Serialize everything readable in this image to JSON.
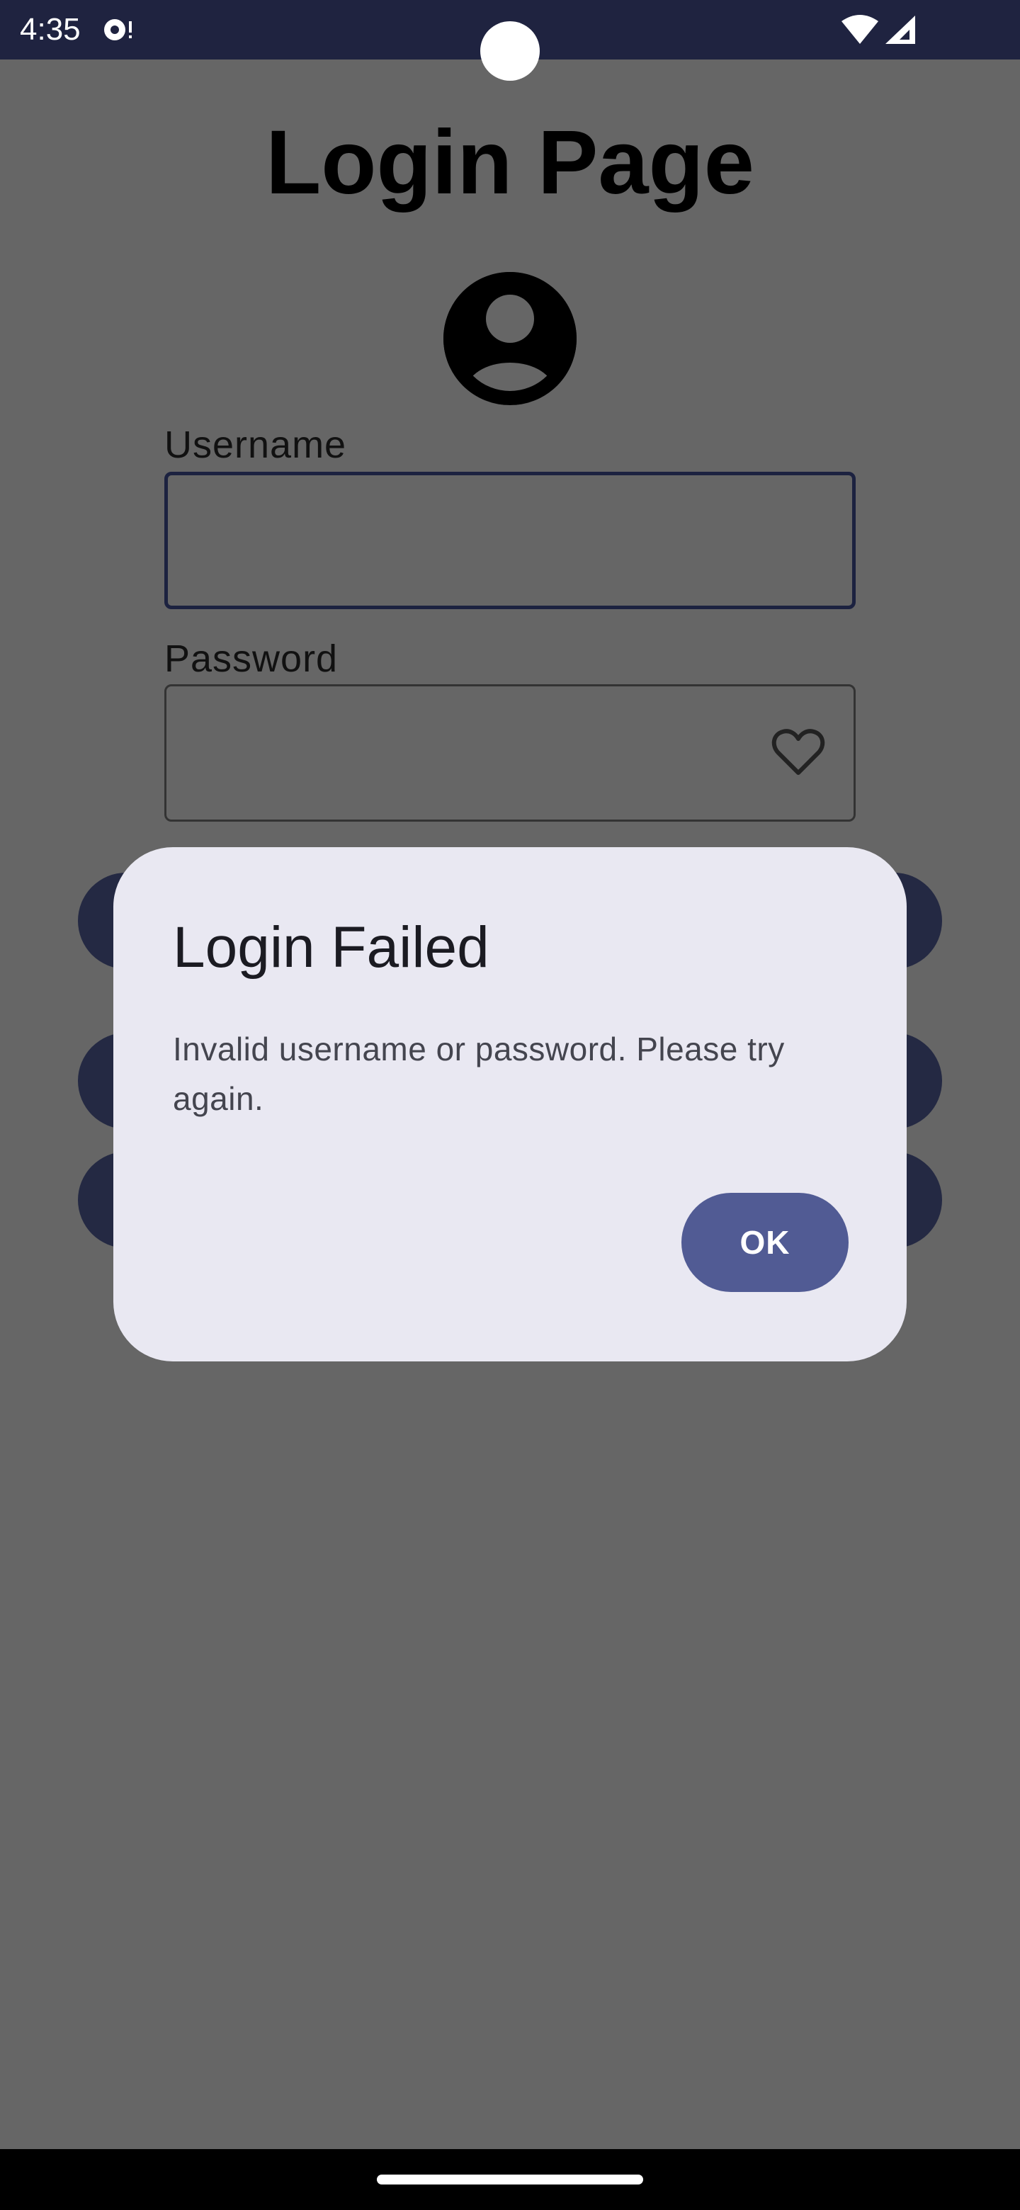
{
  "status_bar": {
    "time": "4:35",
    "icons": [
      "notification-icon",
      "wifi-icon",
      "signal-icon"
    ]
  },
  "page": {
    "title": "Login Page",
    "avatar_icon": "account-circle-icon",
    "username": {
      "label": "Username",
      "value": ""
    },
    "password": {
      "label": "Password",
      "value": "",
      "trailing_icon": "heart-outline-icon"
    }
  },
  "dialog": {
    "title": "Login Failed",
    "message": "Invalid username or password. Please try again.",
    "confirm_label": "OK"
  },
  "colors": {
    "scrim": "#666666",
    "status_bar": "#1f2340",
    "dialog_surface": "#e9e8f2",
    "primary_button": "#515b94",
    "focused_outline": "#1c2240"
  }
}
